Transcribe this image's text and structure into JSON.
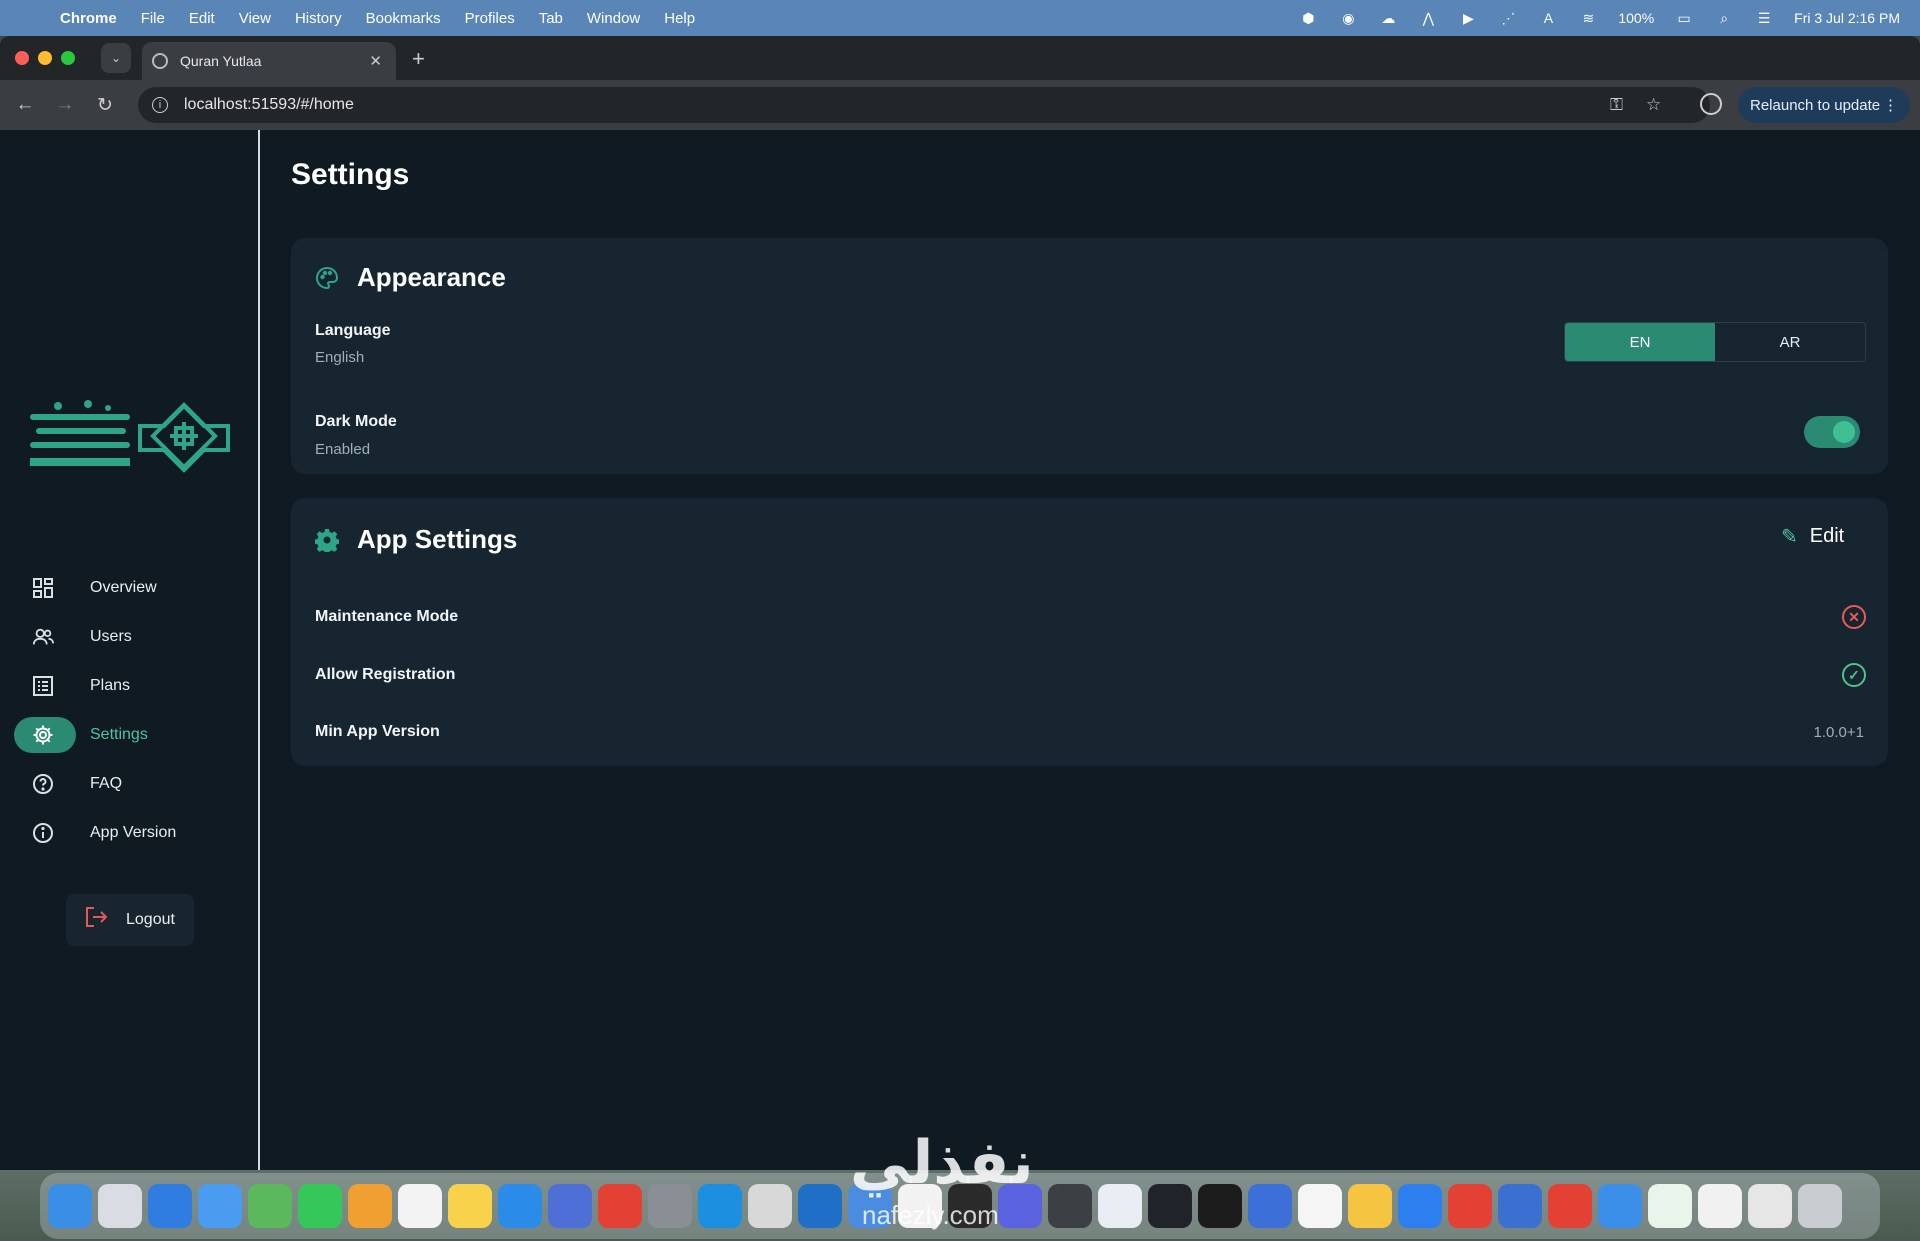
{
  "menubar": {
    "app": "Chrome",
    "items": [
      "File",
      "Edit",
      "View",
      "History",
      "Bookmarks",
      "Profiles",
      "Tab",
      "Window",
      "Help"
    ],
    "battery": "100%",
    "datetime": "Fri 3 Jul  2:16 PM"
  },
  "browser": {
    "tab_title": "Quran Yutlaa",
    "url": "localhost:51593/#/home",
    "relaunch_label": "Relaunch to update"
  },
  "sidebar": {
    "items": [
      {
        "label": "Overview",
        "icon": "grid-icon"
      },
      {
        "label": "Users",
        "icon": "users-icon"
      },
      {
        "label": "Plans",
        "icon": "list-icon"
      },
      {
        "label": "Settings",
        "icon": "gear-icon",
        "active": true
      },
      {
        "label": "FAQ",
        "icon": "help-circle-icon"
      },
      {
        "label": "App Version",
        "icon": "info-icon"
      }
    ],
    "logout_label": "Logout"
  },
  "page": {
    "title": "Settings",
    "appearance": {
      "title": "Appearance",
      "language_label": "Language",
      "language_value": "English",
      "lang_options": [
        "EN",
        "AR"
      ],
      "lang_selected": "EN",
      "dark_mode_label": "Dark Mode",
      "dark_mode_value": "Enabled"
    },
    "app_settings": {
      "title": "App Settings",
      "edit_label": "Edit",
      "maintenance_label": "Maintenance Mode",
      "registration_label": "Allow Registration",
      "min_version_label": "Min App Version",
      "min_version_value": "1.0.0+1"
    }
  },
  "watermark": {
    "arabic": "نفذلي",
    "latin": "nafezly.com"
  },
  "colors": {
    "accent": "#2b8a72",
    "background": "#0f1a22",
    "card": "#16252f",
    "error": "#e85b5b",
    "success": "#4fc38a"
  }
}
